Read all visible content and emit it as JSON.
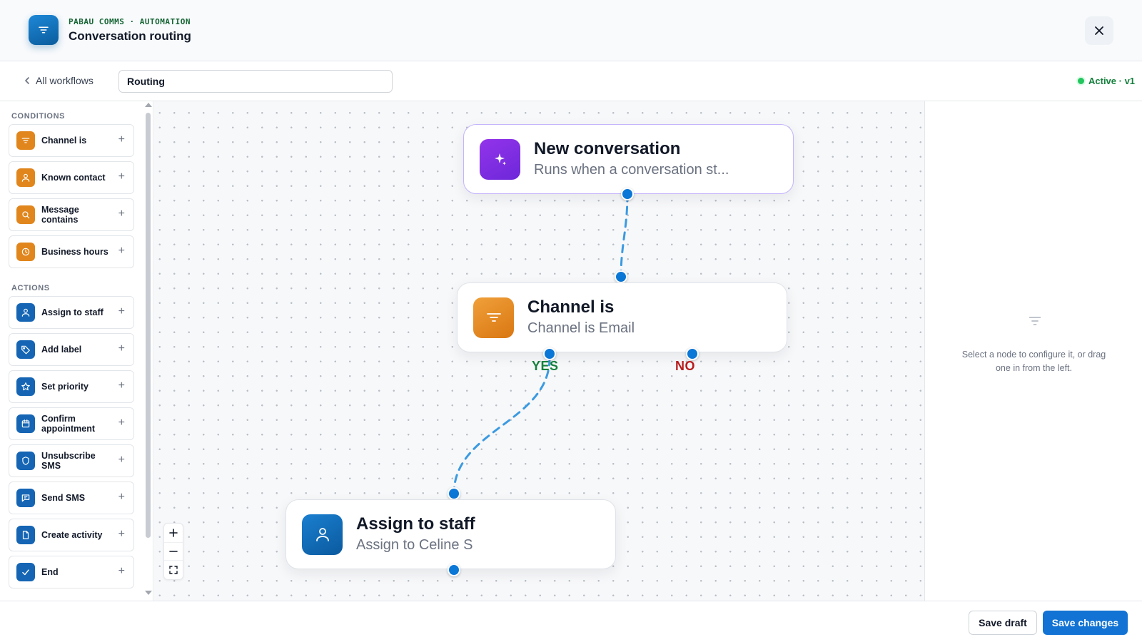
{
  "header": {
    "eyebrow": "PABAU COMMS · AUTOMATION",
    "title": "Conversation routing",
    "logo_icon": "filter-icon",
    "close_icon": "close-icon"
  },
  "toolbar": {
    "back_label": "All workflows",
    "workflow_name": "Routing",
    "status": "Active · v1",
    "status_color": "#22c55e"
  },
  "sidebar": {
    "conditions_label": "CONDITIONS",
    "conditions": [
      {
        "label": "Channel is",
        "icon": "filter-icon"
      },
      {
        "label": "Known contact",
        "icon": "user-icon"
      },
      {
        "label": "Message contains",
        "icon": "search-icon"
      },
      {
        "label": "Business hours",
        "icon": "clock-icon"
      }
    ],
    "actions_label": "ACTIONS",
    "actions": [
      {
        "label": "Assign to staff",
        "icon": "user-icon"
      },
      {
        "label": "Add label",
        "icon": "tag-icon"
      },
      {
        "label": "Set priority",
        "icon": "star-icon"
      },
      {
        "label": "Confirm appointment",
        "icon": "calendar-icon"
      },
      {
        "label": "Unsubscribe SMS",
        "icon": "shield-icon"
      },
      {
        "label": "Send SMS",
        "icon": "message-icon"
      },
      {
        "label": "Create activity",
        "icon": "document-icon"
      },
      {
        "label": "End",
        "icon": "check-icon"
      }
    ],
    "add_symbol": "+"
  },
  "canvas": {
    "nodes": [
      {
        "title": "New conversation",
        "subtitle": "Runs when a conversation st...",
        "icon": "sparkle-icon",
        "color": "#7c3aed"
      },
      {
        "title": "Channel is",
        "subtitle": "Channel is Email",
        "icon": "filter-icon",
        "color": "#e0861d"
      },
      {
        "title": "Assign to staff",
        "subtitle": "Assign to Celine S",
        "icon": "user-icon",
        "color": "#1565b4"
      }
    ],
    "branch_yes": "YES",
    "branch_no": "NO",
    "edge_color": "#3b9ae1"
  },
  "inspector": {
    "icon": "filter-icon",
    "hint": "Select a node to configure it, or drag one in from the left."
  },
  "footer": {
    "save_draft": "Save draft",
    "save_changes": "Save changes",
    "accent": "#1273d4"
  }
}
